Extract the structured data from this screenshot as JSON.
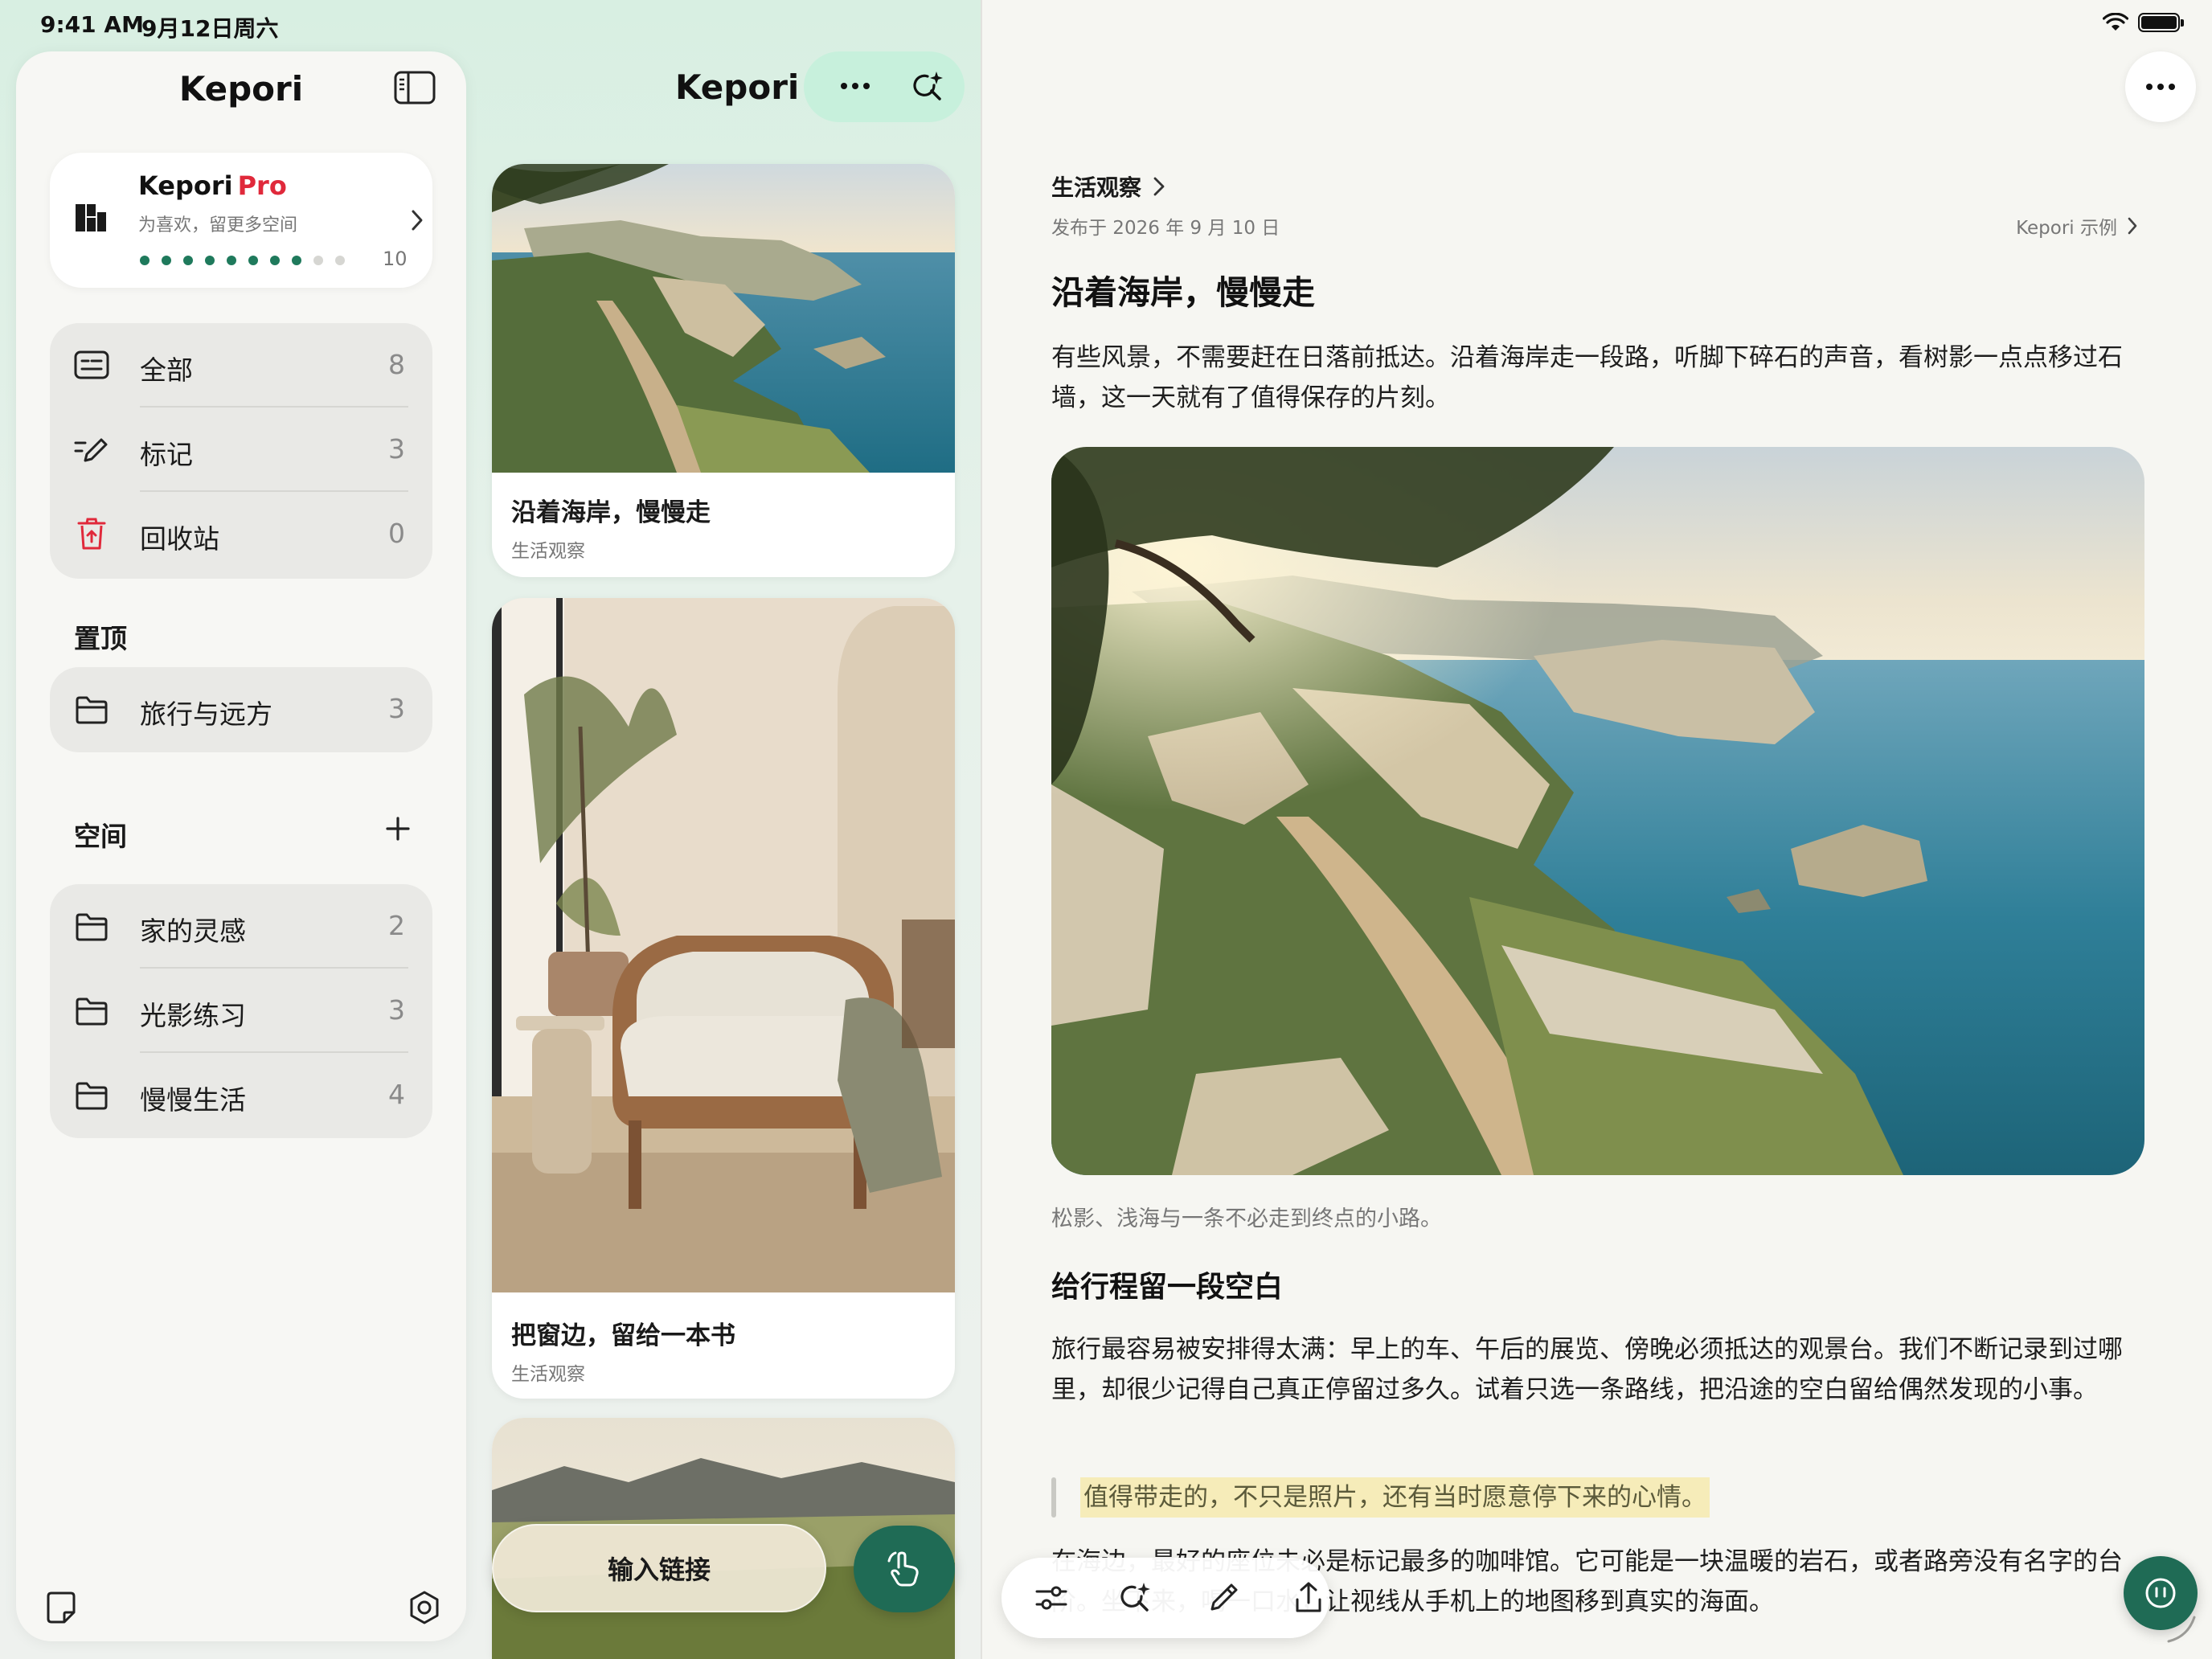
{
  "status": {
    "time": "9:41 AM",
    "date": "9月12日周六"
  },
  "sidebar": {
    "title": "Kepori",
    "pro": {
      "name": "Kepori",
      "badge": "Pro",
      "subtitle": "为喜欢，留更多空间",
      "progress": 8,
      "progress_max": 10,
      "count": "10"
    },
    "library": [
      {
        "label": "全部",
        "count": "8",
        "icon": "all-notes-icon"
      },
      {
        "label": "标记",
        "count": "3",
        "icon": "highlight-pen-icon"
      },
      {
        "label": "回收站",
        "count": "0",
        "icon": "trash-icon"
      }
    ],
    "pinned_header": "置顶",
    "pinned": [
      {
        "label": "旅行与远方",
        "count": "3",
        "icon": "folder-icon"
      }
    ],
    "spaces_header": "空间",
    "spaces": [
      {
        "label": "家的灵感",
        "count": "2",
        "icon": "folder-icon"
      },
      {
        "label": "光影练习",
        "count": "3",
        "icon": "folder-icon"
      },
      {
        "label": "慢慢生活",
        "count": "4",
        "icon": "folder-icon"
      }
    ]
  },
  "middle": {
    "title": "Kepori",
    "cards": [
      {
        "title": "沿着海岸，慢慢走",
        "category": "生活观察"
      },
      {
        "title": "把窗边，留给一本书",
        "category": "生活观察"
      }
    ],
    "link_button": "输入链接"
  },
  "article": {
    "breadcrumb": "生活观察",
    "published": "发布于 2026 年 9 月 10 日",
    "source": "Kepori 示例",
    "title": "沿着海岸，慢慢走",
    "intro": "有些风景，不需要赶在日落前抵达。沿着海岸走一段路，听脚下碎石的声音，看树影一点点移过石墙，这一天就有了值得保存的片刻。",
    "caption": "松影、浅海与一条不必走到终点的小路。",
    "h2": "给行程留一段空白",
    "body": "旅行最容易被安排得太满：早上的车、午后的展览、傍晚必须抵达的观景台。我们不断记录到过哪里，却很少记得自己真正停留过多久。试着只选一条路线，把沿途的空白留给偶然发现的小事。",
    "quote": "值得带走的，不只是照片，还有当时愿意停下来的心情。",
    "body2": "在海边，最好的座位未必是标记最多的咖啡馆。它可能是一块温暖的岩石，或者路旁没有名字的台阶。坐下来，喝一口水，让视线从手机上的地图移到真实的海面。"
  },
  "colors": {
    "accent": "#1f6b55",
    "pro_red": "#e0293b",
    "mint": "#c7f0dc",
    "highlight": "#f6ecb9"
  }
}
